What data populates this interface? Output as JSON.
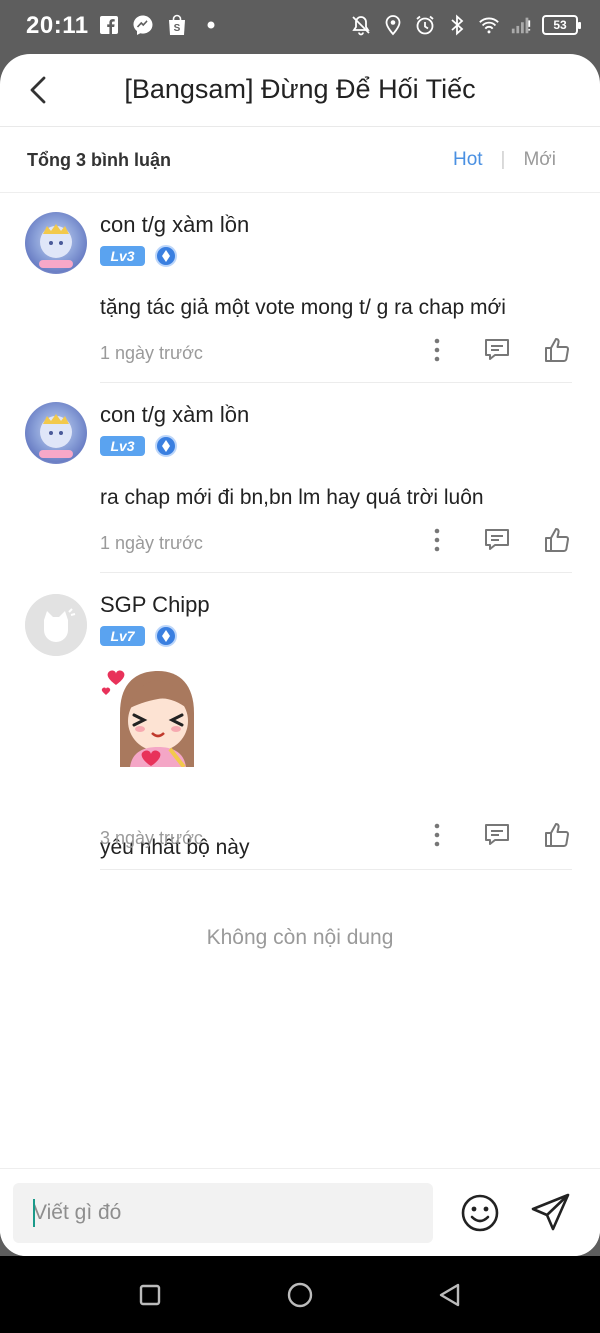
{
  "status_bar": {
    "time": "20:11",
    "battery": "53",
    "left_icons": [
      "facebook-icon",
      "messenger-icon",
      "shopee-icon",
      "dot-icon"
    ],
    "right_icons": [
      "mute-icon",
      "location-icon",
      "alarm-icon",
      "bluetooth-icon",
      "wifi-icon",
      "signal-icon"
    ]
  },
  "header": {
    "title": "[Bangsam] Đừng Để Hối Tiếc"
  },
  "summary": {
    "total": "Tổng 3 bình luận",
    "sort_hot": "Hot",
    "sort_separator": "|",
    "sort_new": "Mới"
  },
  "comments": [
    {
      "username": "con t/g xàm lồn",
      "level": "Lv3",
      "text": "tặng tác giả một vote mong t/ g ra chap mới",
      "time": "1 ngày trước"
    },
    {
      "username": "con t/g xàm lồn",
      "level": "Lv3",
      "text": "ra chap mới đi bn,bn lm hay quá trời luôn",
      "time": "1 ngày trước"
    },
    {
      "username": "SGP Chipp",
      "level": "Lv7",
      "text": "yêu nhất bộ này",
      "time": "3 ngày trước",
      "sticker": "laughing-girl-sticker"
    }
  ],
  "end_message": "Không còn nội dung",
  "input": {
    "placeholder": "Viết gì đó"
  },
  "colors": {
    "accent": "#4a90e2",
    "level_badge": "#5aa3f0",
    "muted": "#9a9a9a"
  }
}
